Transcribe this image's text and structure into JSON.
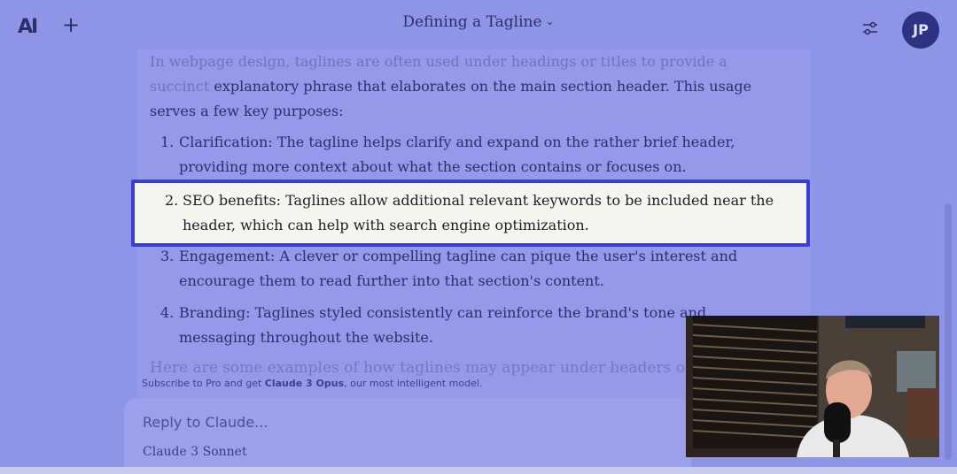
{
  "header": {
    "logo_text": "AI",
    "new_chat_symbol": "+",
    "title": "Defining a Tagline",
    "title_chevron": "⌄",
    "settings_icon": "sliders-icon",
    "avatar_initials": "JP"
  },
  "content": {
    "intro_line1": "In webpage design, taglines are often used under headings or titles to provide a succinct",
    "intro_rest": "explanatory phrase that elaborates on the main section header. This usage serves a few key purposes:",
    "items": [
      {
        "num": "1.",
        "text": "Clarification: The tagline helps clarify and expand on the rather brief header, providing more context about what the section contains or focuses on."
      },
      {
        "num": "2.",
        "text": "SEO benefits: Taglines allow additional relevant keywords to be included near the header, which can help with search engine optimization."
      },
      {
        "num": "3.",
        "text": "Engagement: A clever or compelling tagline can pique the user's interest and encourage them to read further into that section's content."
      },
      {
        "num": "4.",
        "text": "Branding: Taglines styled consistently can reinforce the brand's tone and messaging throughout the website."
      }
    ],
    "trailing_line": "Here are some examples of how taglines may appear under headers on a webpa"
  },
  "promo": {
    "prefix": "Subscribe to Pro and get ",
    "bold": "Claude 3 Opus",
    "suffix": ", our most intelligent model."
  },
  "composer": {
    "placeholder": "Reply to Claude...",
    "model": "Claude 3 Sonnet"
  },
  "colors": {
    "background": "#8f95e6",
    "highlight_border": "#3a3fd1",
    "highlight_fill": "#f5f5ef",
    "avatar_bg": "#2d3380"
  },
  "overlay": {
    "webcam_icon": "webcam-presenter-icon"
  }
}
